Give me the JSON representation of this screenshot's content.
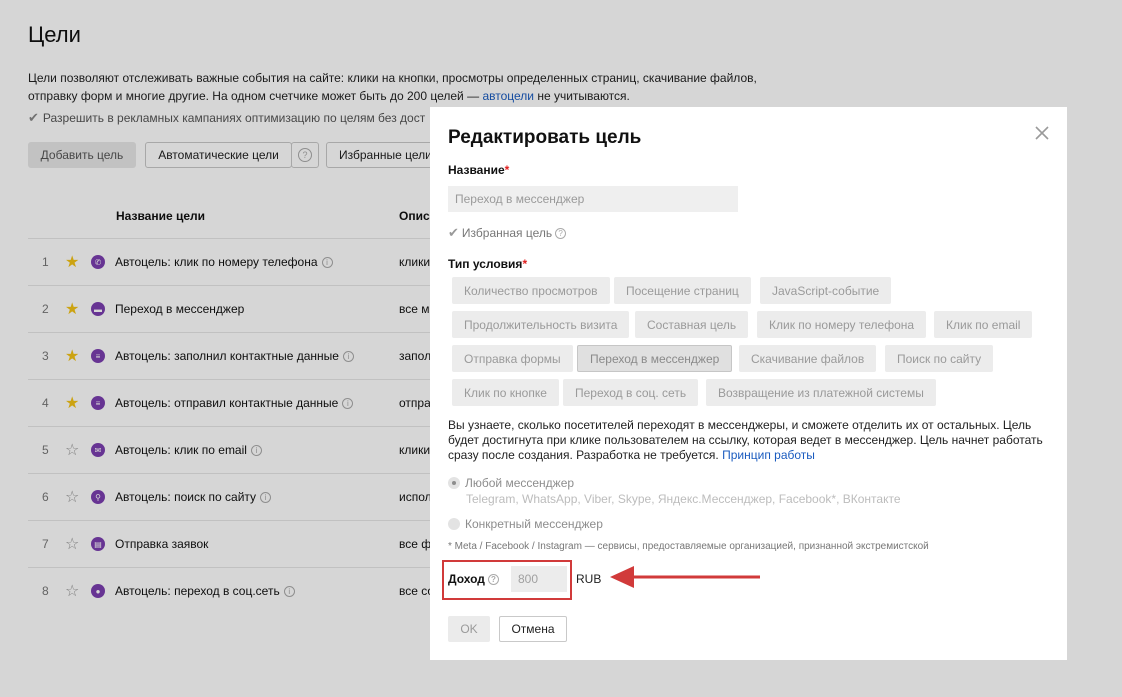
{
  "page": {
    "title": "Цели",
    "description_line1": "Цели позволяют отслеживать важные события на сайте: клики на кнопки, просмотры определенных страниц, скачивание файлов,",
    "description_line2_before": "отправку форм и многие другие. На одном счетчике может быть до 200 целей — ",
    "description_link": "автоцели",
    "description_line2_after": " не учитываются.",
    "permission_text": "Разрешить в рекламных кампаниях оптимизацию по целям без дост"
  },
  "toolbar": {
    "add_goal": "Добавить цель",
    "auto_goals": "Автоматические цели",
    "help": "?",
    "favorite_goals": "Избранные цели"
  },
  "table": {
    "col_name": "Название цели",
    "col_desc": "Опис",
    "rows": [
      {
        "num": "1",
        "favorite": true,
        "icon": "phone-icon",
        "name": "Автоцель: клик по номеру телефона",
        "info": true,
        "desc": "клики"
      },
      {
        "num": "2",
        "favorite": true,
        "icon": "chat-icon",
        "name": "Переход в мессенджер",
        "info": false,
        "desc": "все м"
      },
      {
        "num": "3",
        "favorite": true,
        "icon": "form-icon",
        "name": "Автоцель: заполнил контактные данные",
        "info": true,
        "desc": "запол"
      },
      {
        "num": "4",
        "favorite": true,
        "icon": "form-icon",
        "name": "Автоцель: отправил контактные данные",
        "info": true,
        "desc": "отпра"
      },
      {
        "num": "5",
        "favorite": false,
        "icon": "mail-icon",
        "name": "Автоцель: клик по email",
        "info": true,
        "desc": "клики"
      },
      {
        "num": "6",
        "favorite": false,
        "icon": "search-icon",
        "name": "Автоцель: поиск по сайту",
        "info": true,
        "desc": "испол"
      },
      {
        "num": "7",
        "favorite": false,
        "icon": "document-icon",
        "name": "Отправка заявок",
        "info": false,
        "desc": "все ф"
      },
      {
        "num": "8",
        "favorite": false,
        "icon": "user-icon",
        "name": "Автоцель: переход в соц.сеть",
        "info": true,
        "desc": "все со"
      }
    ]
  },
  "modal": {
    "title": "Редактировать цель",
    "name_label": "Название",
    "required_mark": "*",
    "name_value": "Переход в мессенджер",
    "favorite_label": "Избранная цель",
    "condition_label": "Тип условия",
    "conditions_row1": [
      "Количество просмотров",
      "Посещение страниц",
      "JavaScript-событие"
    ],
    "conditions_row2": [
      "Продолжительность визита",
      "Составная цель",
      "Клик по номеру телефона",
      "Клик по email"
    ],
    "conditions_row3": [
      "Отправка формы",
      "Переход в мессенджер",
      "Скачивание файлов",
      "Поиск по сайту"
    ],
    "conditions_row4": [
      "Клик по кнопке",
      "Переход в соц. сеть",
      "Возвращение из платежной системы"
    ],
    "selected_condition": "Переход в мессенджер",
    "info_line1": "Вы узнаете, сколько посетителей переходят в мессенджеры, и сможете отделить их от остальных. Цель",
    "info_line2": "будет достигнута при клике пользователем на ссылку, которая ведет в мессенджер. Цель начнет работать",
    "info_line3": "сразу после создания. Разработка не требуется. ",
    "info_link": "Принцип работы",
    "radio_any": "Любой мессенджер",
    "radio_any_sub": "Telegram, WhatsApp, Viber, Skype, Яндекс.Мессенджер, Facebook*, ВКонтакте",
    "radio_specific": "Конкретный мессенджер",
    "footnote": "* Meta / Facebook / Instagram — сервисы, предоставляемые организацией, признанной экстремистской",
    "income_label": "Доход",
    "income_value": "800",
    "currency": "RUB",
    "ok": "OK",
    "cancel": "Отмена"
  },
  "colors": {
    "highlight": "#d13a3a",
    "link": "#1a5bbf",
    "goal_icon": "#7b3fb0",
    "star": "#f3c316"
  }
}
